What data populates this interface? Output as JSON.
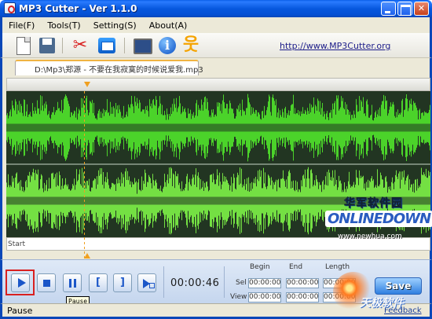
{
  "window": {
    "title": "MP3 Cutter - Ver 1.1.0"
  },
  "menu": {
    "items": [
      "File(F)",
      "Tools(T)",
      "Setting(S)",
      "About(A)"
    ]
  },
  "toolbar": {
    "url": "http://www.MP3Cutter.org",
    "icons": [
      "new-file-icon",
      "save-icon",
      "scissors-icon",
      "email-icon",
      "screen-icon",
      "info-icon",
      "running-man-icon"
    ]
  },
  "file_tab": {
    "label": "D:\\Mp3\\郑源 - 不要在我寂寞的时候说爱我.mp3"
  },
  "waveform": {
    "start_label": "Start",
    "colors": {
      "background": "#223522",
      "wave": "#4bd32a",
      "wave_light": "#74e043"
    }
  },
  "controls": {
    "time": "00:00:46",
    "headers": {
      "begin": "Begin",
      "end": "End",
      "length": "Length"
    },
    "rows": [
      {
        "label": "Sel",
        "begin": "00:00:00",
        "end": "00:00:00",
        "length": "00:00:00"
      },
      {
        "label": "View",
        "begin": "00:00:00",
        "end": "00:00:00",
        "length": "00:00:00"
      }
    ],
    "save_label": "Save",
    "tooltip": "Pause"
  },
  "status": {
    "text": "Pause",
    "feedback": "Feedback"
  },
  "watermark": {
    "cn": "华军软件园",
    "logo": "ONLINEDOWN",
    "url": "www.newhua.com",
    "bottom": "天极软件"
  }
}
